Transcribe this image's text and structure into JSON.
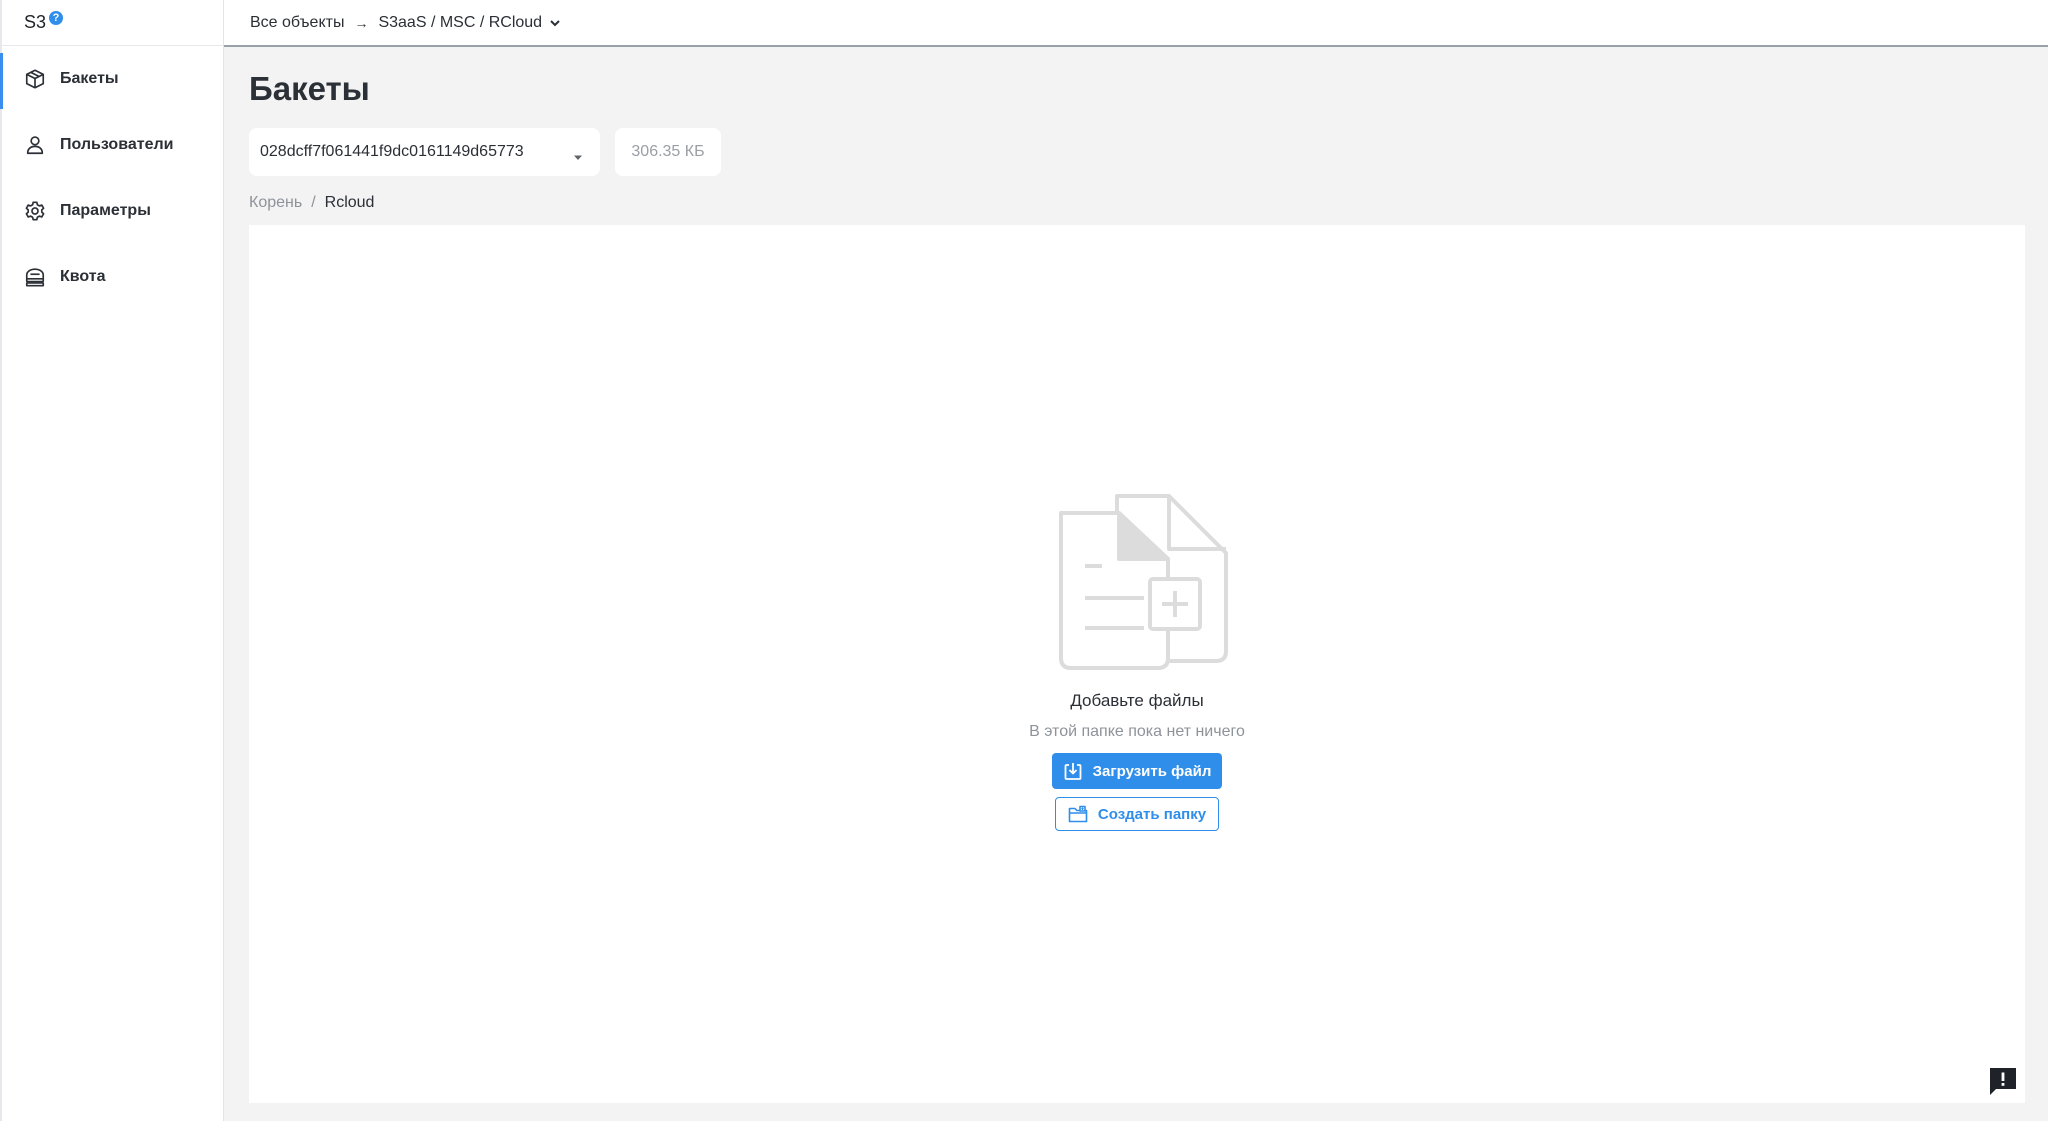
{
  "app": {
    "logo": "S3",
    "help_glyph": "?"
  },
  "sidebar": {
    "items": [
      {
        "label": "Бакеты",
        "icon": "box-icon",
        "active": true
      },
      {
        "label": "Пользователи",
        "icon": "user-icon",
        "active": false
      },
      {
        "label": "Параметры",
        "icon": "gear-icon",
        "active": false
      },
      {
        "label": "Квота",
        "icon": "quota-icon",
        "active": false
      }
    ]
  },
  "topbar": {
    "all_objects": "Все объекты",
    "arrow": "→",
    "project_path": "S3aaS / MSC / RCloud"
  },
  "main": {
    "title": "Бакеты",
    "bucket_select_value": "028dcff7f061441f9dc0161149d65773",
    "bucket_size": "306.35 КБ",
    "breadcrumb": {
      "root": "Корень",
      "separator": "/",
      "current": "Rcloud"
    },
    "empty_state": {
      "title": "Добавьте файлы",
      "subtitle": "В этой папке пока нет ничего",
      "upload_label": "Загрузить файл",
      "create_folder_label": "Создать папку"
    }
  },
  "colors": {
    "accent": "#2f8eea",
    "active_indicator": "#3a8ef0",
    "background": "#f3f3f4"
  },
  "feedback": {
    "icon": "feedback-icon",
    "glyph": "!"
  }
}
